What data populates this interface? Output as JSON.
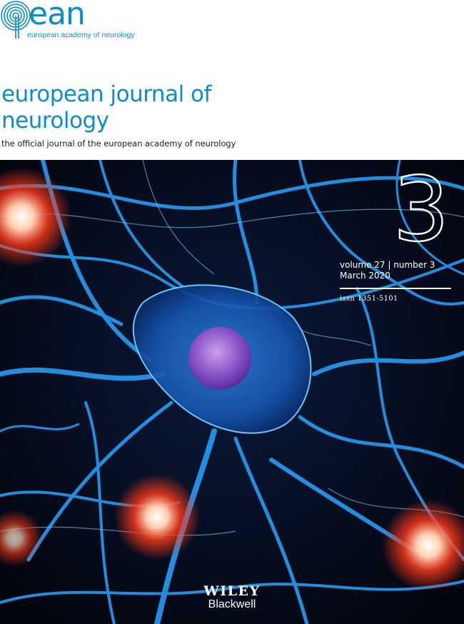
{
  "logo": {
    "wordmark": "ean",
    "tagline": "european academy of neurology",
    "icon": "brain-swirl-icon"
  },
  "journal": {
    "title": "european journal of neurology",
    "subtitle": "the official journal of the european academy of neurology"
  },
  "issue": {
    "number": "3",
    "volume_line": "volume 27 | number 3",
    "date": "March 2020",
    "issn": "issn 1351-5101"
  },
  "publisher": {
    "line1": "WILEY",
    "line2": "Blackwell"
  },
  "cover_image": {
    "description_icon": "neuron-network-image"
  },
  "colors": {
    "brand_blue": "#0a8cd0",
    "background": "#030612",
    "neuron_blue": "#2aa4ff",
    "glow_red": "#ff3a1a"
  }
}
